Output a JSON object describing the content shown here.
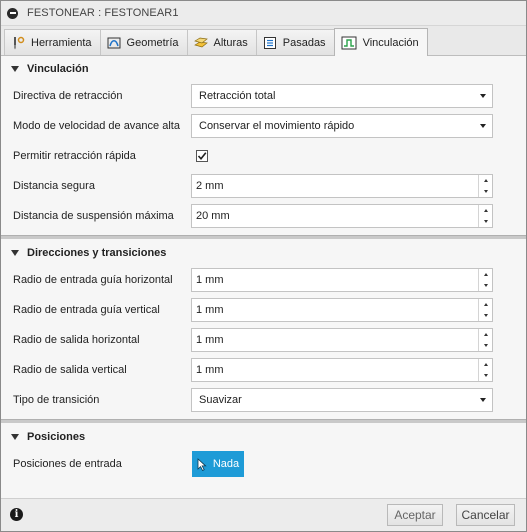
{
  "window": {
    "title": "FESTONEAR : FESTONEAR1"
  },
  "tabs": [
    {
      "label": "Herramienta",
      "icon": "tool-icon"
    },
    {
      "label": "Geometría",
      "icon": "geometry-icon"
    },
    {
      "label": "Alturas",
      "icon": "heights-icon"
    },
    {
      "label": "Pasadas",
      "icon": "passes-icon"
    },
    {
      "label": "Vinculación",
      "icon": "linking-icon",
      "active": true
    }
  ],
  "sections": {
    "vinculacion": {
      "title": "Vinculación",
      "retract_policy": {
        "label": "Directiva de retracción",
        "value": "Retracción total"
      },
      "feed_mode": {
        "label": "Modo de velocidad de avance alta",
        "value": "Conservar el movimiento rápido"
      },
      "allow_rapid": {
        "label": "Permitir retracción rápida",
        "checked": true
      },
      "safe_distance": {
        "label": "Distancia segura",
        "value": "2 mm"
      },
      "max_stay_down": {
        "label": "Distancia de suspensión máxima",
        "value": "20 mm"
      }
    },
    "direcciones": {
      "title": "Direcciones y transiciones",
      "lead_in_horizontal": {
        "label": "Radio de entrada guía horizontal",
        "value": "1 mm"
      },
      "lead_in_vertical": {
        "label": "Radio de entrada guía vertical",
        "value": "1 mm"
      },
      "lead_out_horizontal": {
        "label": "Radio de salida horizontal",
        "value": "1 mm"
      },
      "lead_out_vertical": {
        "label": "Radio de salida vertical",
        "value": "1 mm"
      },
      "transition_type": {
        "label": "Tipo de transición",
        "value": "Suavizar"
      }
    },
    "posiciones": {
      "title": "Posiciones",
      "entry_positions": {
        "label": "Posiciones de entrada",
        "button": "Nada"
      }
    }
  },
  "footer": {
    "ok_label": "Aceptar",
    "cancel_label": "Cancelar"
  },
  "colors": {
    "accent": "#1e9bd7"
  }
}
